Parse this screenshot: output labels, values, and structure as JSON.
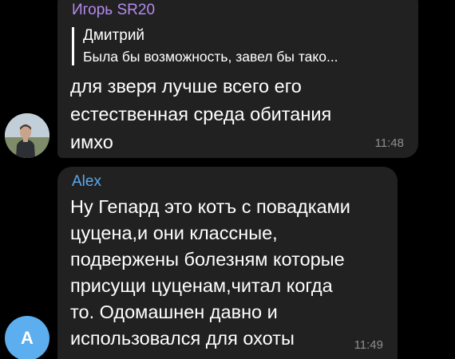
{
  "colors": {
    "background": "#000000",
    "bubble": "#212121",
    "sender1": "#b48bf0",
    "sender2": "#5aa9ee",
    "avatar_letter_bg": "#5caeef"
  },
  "messages": [
    {
      "sender": "Игорь SR20",
      "reply": {
        "author": "Дмитрий",
        "text": "Была бы возможность, завел бы тако..."
      },
      "text": "для зверя лучше всего его\nестественная среда обитания\nимхо",
      "time": "11:48",
      "avatar_icon": "user-photo-icon"
    },
    {
      "sender": "Alex",
      "text": "Ну Гепард это котъ с повадками\nцуцена,и они классные,\nподвержены болезням которые\nприсущи цуценам,читал когда\nто. Одомашнен давно и\nиспользовался для охоты",
      "time": "11:49",
      "avatar_letter": "A"
    }
  ]
}
